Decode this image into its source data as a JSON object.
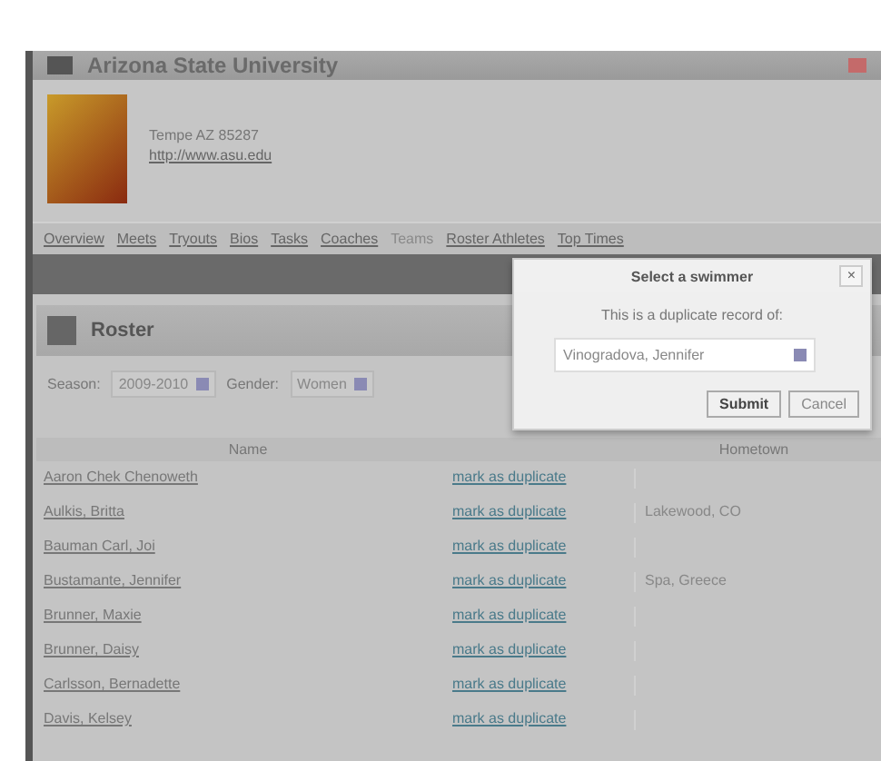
{
  "window": {
    "title": "Arizona State University"
  },
  "school": {
    "address": "Tempe AZ 85287",
    "link": "http://www.asu.edu"
  },
  "nav": [
    {
      "label": "Overview",
      "selected": false
    },
    {
      "label": "Meets",
      "selected": false
    },
    {
      "label": "Tryouts",
      "selected": false
    },
    {
      "label": "Bios",
      "selected": false
    },
    {
      "label": "Tasks",
      "selected": false
    },
    {
      "label": "Coaches",
      "selected": false
    },
    {
      "label": "Teams",
      "selected": true
    },
    {
      "label": "Roster Athletes",
      "selected": false
    },
    {
      "label": "Top Times",
      "selected": false
    }
  ],
  "roster": {
    "title": "Roster",
    "season_label": "Season:",
    "season": "2009-2010",
    "gender_label": "Gender:",
    "gender": "Women",
    "columns": [
      "Name",
      "",
      "Hometown"
    ],
    "rows": [
      {
        "name": "Aaron Chek Chenoweth",
        "action": "mark as duplicate",
        "hometown": ""
      },
      {
        "name": "Aulkis, Britta",
        "action": "mark as duplicate",
        "hometown": "Lakewood, CO"
      },
      {
        "name": "Bauman Carl, Joi",
        "action": "mark as duplicate",
        "hometown": ""
      },
      {
        "name": "Bustamante, Jennifer",
        "action": "mark as duplicate",
        "hometown": "Spa, Greece"
      },
      {
        "name": "Brunner, Maxie",
        "action": "mark as duplicate",
        "hometown": ""
      },
      {
        "name": "Brunner, Daisy",
        "action": "mark as duplicate",
        "hometown": ""
      },
      {
        "name": "Carlsson, Bernadette",
        "action": "mark as duplicate",
        "hometown": ""
      },
      {
        "name": "Davis, Kelsey",
        "action": "mark as duplicate",
        "hometown": ""
      }
    ]
  },
  "dialog": {
    "title": "Select a swimmer",
    "close": "×",
    "prompt": "This is a duplicate record of:",
    "select": "Vinogradova, Jennifer",
    "buttons": [
      "Submit",
      "Cancel"
    ]
  }
}
